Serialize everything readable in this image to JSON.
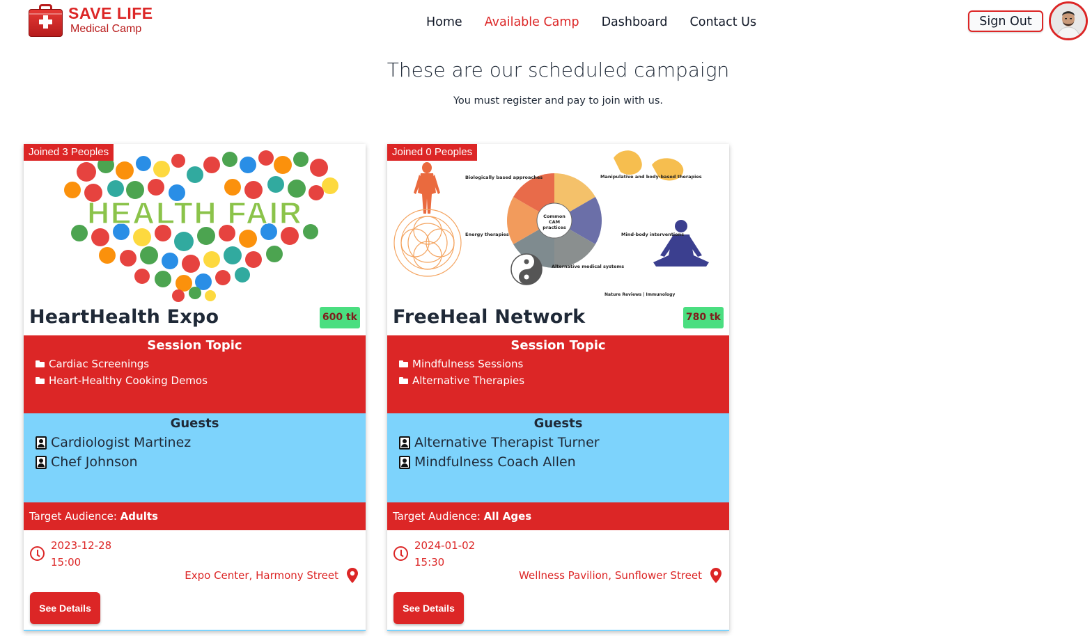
{
  "brand": {
    "title": "SAVE LIFE",
    "subtitle": "Medical Camp"
  },
  "nav": [
    {
      "label": "Home",
      "active": false
    },
    {
      "label": "Available Camp",
      "active": true
    },
    {
      "label": "Dashboard",
      "active": false
    },
    {
      "label": "Contact Us",
      "active": false
    }
  ],
  "header": {
    "signout_label": "Sign Out"
  },
  "hero": {
    "title": "These are our scheduled campaign",
    "subtitle": "You must register and pay to join with us."
  },
  "camps": [
    {
      "joined": "Joined 3 Peoples",
      "image_icon": "health-fair-heart-image",
      "image_title": "HEALTH FAIR",
      "name": "HeartHealth Expo",
      "price": "600 tk",
      "session_heading": "Session Topic",
      "topics": [
        "Cardiac Screenings",
        "Heart-Healthy Cooking Demos"
      ],
      "guests_heading": "Guests",
      "guests": [
        "Cardiologist Martinez",
        "Chef Johnson"
      ],
      "audience_label": "Target Audience: ",
      "audience_value": "Adults",
      "date": "2023-12-28",
      "time": "15:00",
      "location": "Expo Center, Harmony Street",
      "button": "See Details"
    },
    {
      "joined": "Joined 0 Peoples",
      "image_icon": "cam-practices-diagram-image",
      "image_labels": {
        "bio": "Biologically based approaches",
        "manip": "Manipulative and body-based therapies",
        "energy": "Energy therapies",
        "mind": "Mind-body interventions",
        "center": "Common CAM practices",
        "alt": "Alternative medical systems",
        "credit": "Nature Reviews | Immunology"
      },
      "name": "FreeHeal Network",
      "price": "780 tk",
      "session_heading": "Session Topic",
      "topics": [
        "Mindfulness Sessions",
        "Alternative Therapies"
      ],
      "guests_heading": "Guests",
      "guests": [
        "Alternative Therapist Turner",
        "Mindfulness Coach Allen"
      ],
      "audience_label": "Target Audience: ",
      "audience_value": "All Ages",
      "date": "2024-01-02",
      "time": "15:30",
      "location": "Wellness Pavilion, Sunflower Street",
      "button": "See Details"
    }
  ],
  "colors": {
    "primary": "#dc2626",
    "guests_bg": "#7dd3fc",
    "price_bg": "#4ade80"
  }
}
